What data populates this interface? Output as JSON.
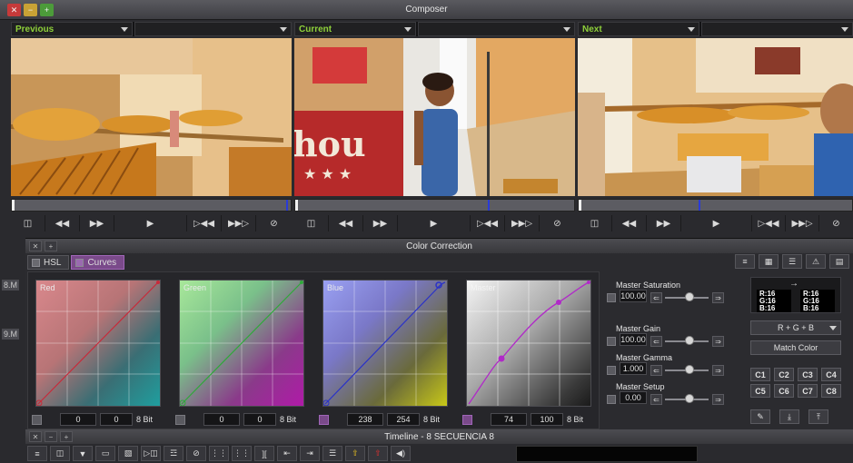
{
  "composer": {
    "title": "Composer",
    "window_buttons": [
      "✕",
      "−",
      "+"
    ],
    "monitors": [
      {
        "label": "Previous"
      },
      {
        "label": "Current"
      },
      {
        "label": "Next"
      }
    ],
    "transport_icons": [
      "monitor-icon",
      "rewind-icon",
      "fast-forward-icon",
      "play-icon",
      "mark-in-icon",
      "mark-out-icon",
      "clear-marks-icon"
    ]
  },
  "left_strip": {
    "numbers": [
      "8.M",
      "9.M"
    ]
  },
  "color_correction": {
    "title": "Color Correction",
    "title_buttons": [
      "✕",
      "+"
    ],
    "tabs": [
      {
        "label": "HSL",
        "active": false
      },
      {
        "label": "Curves",
        "active": true
      }
    ],
    "curves": [
      {
        "name": "Red",
        "in": "0",
        "out": "0",
        "bits": "8 Bit",
        "color": "#c8404a"
      },
      {
        "name": "Green",
        "in": "0",
        "out": "0",
        "bits": "8 Bit",
        "color": "#3aa84a"
      },
      {
        "name": "Blue",
        "in": "238",
        "out": "254",
        "bits": "8 Bit",
        "color": "#3a44d0"
      },
      {
        "name": "Master",
        "in": "74",
        "out": "100",
        "bits": "8 Bit",
        "color": "#b040c8"
      }
    ],
    "sliders": [
      {
        "label": "Master Saturation",
        "value": "100.00"
      },
      {
        "label": "Master Gain",
        "value": "100.00"
      },
      {
        "label": "Master Gamma",
        "value": "1.000"
      },
      {
        "label": "Master Setup",
        "value": "0.00"
      }
    ],
    "match": {
      "arrow": "→",
      "left_rgb": [
        "R:16",
        "G:16",
        "B:16"
      ],
      "right_rgb": [
        "R:16",
        "G:16",
        "B:16"
      ],
      "dropdown": "R + G + B",
      "button": "Match Color",
      "c_buttons": [
        "C1",
        "C2",
        "C3",
        "C4",
        "C5",
        "C6",
        "C7",
        "C8"
      ]
    }
  },
  "timeline": {
    "title": "Timeline - 8 SECUENCIA 8",
    "title_buttons": [
      "✕",
      "−",
      "+"
    ]
  }
}
